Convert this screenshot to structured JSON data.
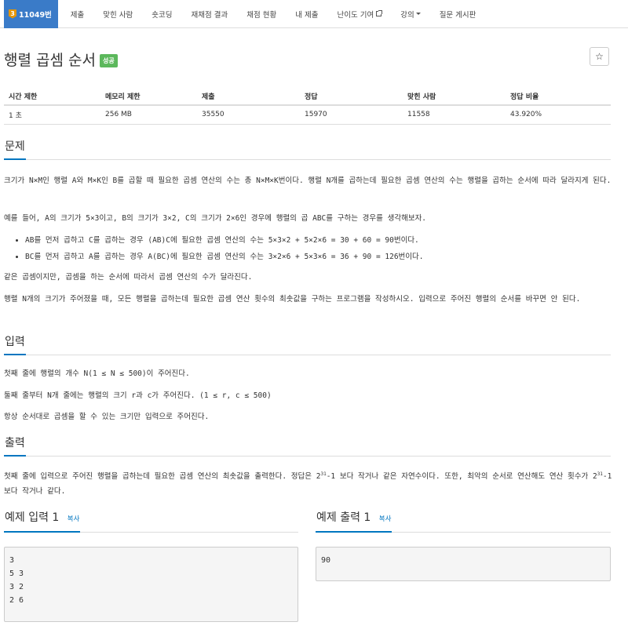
{
  "nav": {
    "problem_number": "11049번",
    "items": [
      "제출",
      "맞힌 사람",
      "숏코딩",
      "재채점 결과",
      "채점 현황",
      "내 제출",
      "난이도 기여",
      "강의",
      "질문 게시판"
    ]
  },
  "tier_icon": "gold-3-tier-icon",
  "tier_color": "#e59500",
  "title": "행렬 곱셈 순서",
  "status_badge": "성공",
  "star": "☆",
  "info": {
    "headers": [
      "시간 제한",
      "메모리 제한",
      "제출",
      "정답",
      "맞힌 사람",
      "정답 비율"
    ],
    "values": [
      "1 초",
      "256 MB",
      "35550",
      "15970",
      "11558",
      "43.920%"
    ]
  },
  "sections": {
    "problem": "문제",
    "input": "입력",
    "output": "출력",
    "sample_input": "예제 입력 1",
    "sample_output": "예제 출력 1",
    "copy": "복사"
  },
  "problem": {
    "p1": "크기가 N×M인 행렬 A와 M×K인 B를 곱할 때 필요한 곱셈 연산의 수는 총 N×M×K번이다. 행렬 N개를 곱하는데 필요한 곱셈 연산의 수는 행렬을 곱하는 순서에 따라 달라지게 된다.",
    "p2": "예를 들어, A의 크기가 5×3이고, B의 크기가 3×2, C의 크기가 2×6인 경우에 행렬의 곱 ABC를 구하는 경우를 생각해보자.",
    "b1": "AB를 먼저 곱하고 C를 곱하는 경우 (AB)C에 필요한 곱셈 연산의 수는 5×3×2 + 5×2×6 = 30 + 60 = 90번이다.",
    "b2": "BC를 먼저 곱하고 A를 곱하는 경우 A(BC)에 필요한 곱셈 연산의 수는 3×2×6 + 5×3×6 = 36 + 90 = 126번이다.",
    "p3": "같은 곱셈이지만, 곱셈을 하는 순서에 따라서 곱셈 연산의 수가 달라진다.",
    "p4": "행렬 N개의 크기가 주어졌을 때, 모든 행렬을 곱하는데 필요한 곱셈 연산 횟수의 최솟값을 구하는 프로그램을 작성하시오. 입력으로 주어진 행렬의 순서를 바꾸면 안 된다."
  },
  "input": {
    "p1": "첫째 줄에 행렬의 개수 N(1 ≤ N ≤ 500)이 주어진다.",
    "p2": "둘째 줄부터 N개 줄에는 행렬의 크기 r과 c가 주어진다. (1 ≤ r, c ≤ 500)",
    "p3": "항상 순서대로 곱셈을 할 수 있는 크기만 입력으로 주어진다."
  },
  "output": {
    "p1a": "첫째 줄에 입력으로 주어진 행렬을 곱하는데 필요한 곱셈 연산의 최솟값을 출력한다. 정답은 2",
    "p1b": "-1 보다 작거나 같은 자연수이다. 또한, 최악의 순서로 연산해도 연산 횟수가 2",
    "p1c": "-1보다 작거나 같다.",
    "exp": "31"
  },
  "sample_input": "3\n5 3\n3 2\n2 6",
  "sample_output": "90"
}
